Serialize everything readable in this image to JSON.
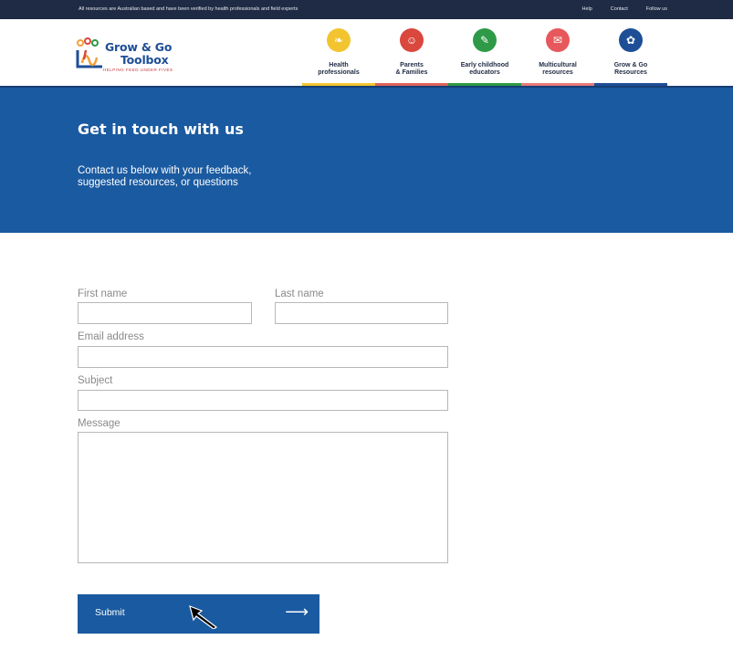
{
  "topbar": {
    "notice": "All resources are Australian based and have been verified by health professionals and field experts",
    "links": [
      "Help",
      "Contact",
      "Follow us"
    ]
  },
  "logo": {
    "line1": "Grow & Go",
    "line2": "Toolbox",
    "tagline": "HELPING FEED UNDER FIVES"
  },
  "nav": [
    {
      "line1": "Health",
      "line2": "professionals",
      "color": "#f2c530",
      "underline": "#f2c530",
      "icon": "leaf-icon"
    },
    {
      "line1": "Parents",
      "line2": "& Families",
      "color": "#d9473d",
      "underline": "#e0625a",
      "icon": "family-icon"
    },
    {
      "line1": "Early childhood",
      "line2": "educators",
      "color": "#2e9a47",
      "underline": "#2e9a47",
      "icon": "feather-icon"
    },
    {
      "line1": "Multicultural",
      "line2": "resources",
      "color": "#e6585b",
      "underline": "#e67a7d",
      "icon": "speech-icon"
    },
    {
      "line1": "Grow & Go",
      "line2": "Resources",
      "color": "#1e4e96",
      "underline": "#1e4e96",
      "icon": "globe-icon"
    }
  ],
  "hero": {
    "title": "Get in touch with us",
    "subtitle": "Contact us below with your feedback, suggested resources, or questions"
  },
  "form": {
    "first_name_label": "First name",
    "last_name_label": "Last name",
    "email_label": "Email address",
    "subject_label": "Subject",
    "message_label": "Message",
    "first_name_value": "",
    "last_name_value": "",
    "email_value": "",
    "subject_value": "",
    "message_value": "",
    "submit_label": "Submit",
    "submit_arrow": "⟶"
  },
  "colors": {
    "brand_blue": "#1a5aa0",
    "topbar": "#1f2a44"
  }
}
